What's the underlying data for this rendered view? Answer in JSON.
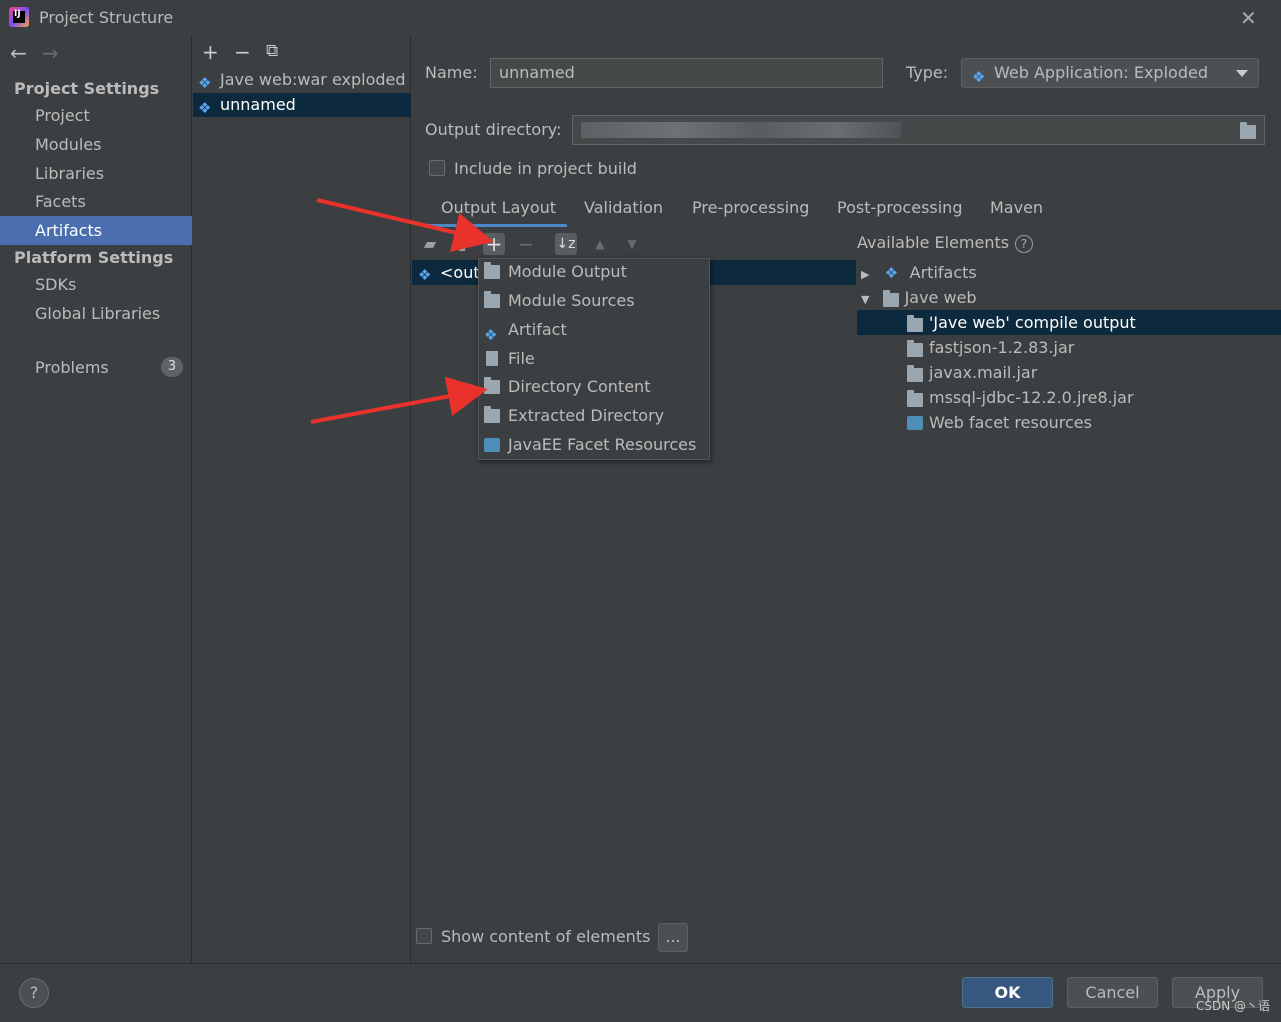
{
  "window": {
    "title": "Project Structure"
  },
  "sidebar": {
    "project_settings_header": "Project Settings",
    "project_items": [
      {
        "label": "Project"
      },
      {
        "label": "Modules"
      },
      {
        "label": "Libraries"
      },
      {
        "label": "Facets"
      },
      {
        "label": "Artifacts",
        "selected": true
      }
    ],
    "platform_settings_header": "Platform Settings",
    "platform_items": [
      {
        "label": "SDKs"
      },
      {
        "label": "Global Libraries"
      }
    ],
    "problems": {
      "label": "Problems",
      "count": "3"
    }
  },
  "artifacts_list": {
    "items": [
      {
        "label": "Jave web:war exploded"
      },
      {
        "label": "unnamed",
        "selected": true
      }
    ]
  },
  "artifact": {
    "name_label": "Name:",
    "name_value": "unnamed",
    "type_label": "Type:",
    "type_value": "Web Application: Exploded",
    "output_dir_label": "Output directory:",
    "include_label": "Include in project build"
  },
  "tabs": [
    {
      "label": "Output Layout",
      "active": true
    },
    {
      "label": "Validation"
    },
    {
      "label": "Pre-processing"
    },
    {
      "label": "Post-processing"
    },
    {
      "label": "Maven"
    }
  ],
  "output_tree": {
    "root_label": "<out"
  },
  "add_menu": {
    "items": [
      {
        "label": "Module Output",
        "icon": "module-output-icon"
      },
      {
        "label": "Module Sources",
        "icon": "module-sources-icon"
      },
      {
        "label": "Artifact",
        "icon": "artifact-icon"
      },
      {
        "label": "File",
        "icon": "file-icon"
      },
      {
        "label": "Directory Content",
        "icon": "folder-icon"
      },
      {
        "label": "Extracted Directory",
        "icon": "extracted-directory-icon"
      },
      {
        "label": "JavaEE Facet Resources",
        "icon": "javaee-facet-icon"
      }
    ]
  },
  "available": {
    "title": "Available Elements",
    "tree": [
      {
        "label": "Artifacts",
        "expanded": false
      },
      {
        "label": "Jave web",
        "expanded": true
      },
      {
        "label": "'Jave web' compile output",
        "selected": true
      },
      {
        "label": "fastjson-1.2.83.jar"
      },
      {
        "label": "javax.mail.jar"
      },
      {
        "label": "mssql-jdbc-12.2.0.jre8.jar"
      },
      {
        "label": "Web facet resources"
      }
    ]
  },
  "show_content_label": "Show content of elements",
  "dots_label": "...",
  "buttons": {
    "ok": "OK",
    "cancel": "Cancel",
    "apply": "Apply"
  },
  "watermark": "CSDN @丶语",
  "colors": {
    "selection": "#4b6eaf",
    "tree_selection": "#0d293e",
    "annotation_arrow": "#e8322b"
  }
}
